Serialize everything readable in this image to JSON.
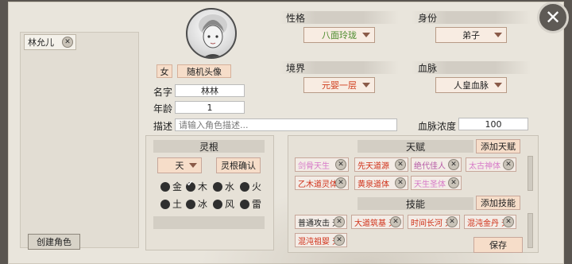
{
  "close_icon": "close-icon",
  "character_list": {
    "items": [
      {
        "name": "林允儿"
      }
    ],
    "create_button": "创建角色"
  },
  "profile": {
    "gender": "女",
    "random_avatar": "随机头像",
    "name_label": "名字",
    "name_value": "林林",
    "age_label": "年龄",
    "age_value": "1",
    "desc_label": "描述",
    "desc_placeholder": "请输入角色描述..."
  },
  "attributes": {
    "personality_label": "性格",
    "personality_value": "八面玲珑",
    "identity_label": "身份",
    "identity_value": "弟子",
    "realm_label": "境界",
    "realm_value": "元婴一层",
    "bloodline_label": "血脉",
    "bloodline_value": "人皇血脉",
    "bloodline_concentration_label": "血脉浓度",
    "bloodline_concentration_value": "100"
  },
  "spirit_root": {
    "title": "灵根",
    "grade": "天",
    "confirm": "灵根确认",
    "elements": [
      {
        "name": "金",
        "checked": false
      },
      {
        "name": "木",
        "checked": true
      },
      {
        "name": "水",
        "checked": false
      },
      {
        "name": "火",
        "checked": false
      },
      {
        "name": "土",
        "checked": false
      },
      {
        "name": "冰",
        "checked": false
      },
      {
        "name": "风",
        "checked": false
      },
      {
        "name": "雷",
        "checked": false
      }
    ]
  },
  "talents": {
    "title": "天赋",
    "add_button": "添加天赋",
    "items": [
      {
        "text": "剑骨天生",
        "color": "#d77ac8"
      },
      {
        "text": "先天道源",
        "color": "#d03018"
      },
      {
        "text": "绝代佳人",
        "color": "#b65aa6"
      },
      {
        "text": "太古神体",
        "color": "#d77ac8"
      },
      {
        "text": "乙木道灵体",
        "color": "#d03018"
      },
      {
        "text": "黄泉道体",
        "color": "#d03018"
      },
      {
        "text": "天生圣体",
        "color": "#d77ac8"
      }
    ]
  },
  "skills": {
    "title": "技能",
    "add_button": "添加技能",
    "items": [
      {
        "text": "普通攻击 无",
        "color": "#222222"
      },
      {
        "text": "大道筑基 无",
        "color": "#d03018"
      },
      {
        "text": "时间长河 无",
        "color": "#d03018"
      },
      {
        "text": "混沌金丹 无",
        "color": "#d03018"
      },
      {
        "text": "混沌祖婴 无",
        "color": "#d03018"
      }
    ],
    "save_button": "保存"
  }
}
